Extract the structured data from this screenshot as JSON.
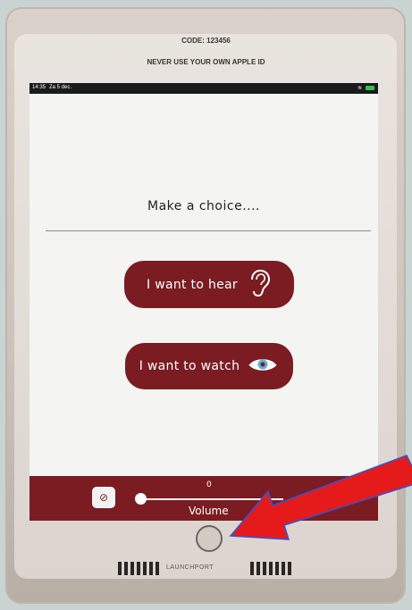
{
  "kiosk": {
    "code_label": "CODE: 123456",
    "warning_label": "NEVER USE YOUR OWN APPLE ID",
    "brand": "LAUNCHPORT"
  },
  "statusbar": {
    "time": "14:35",
    "date": "Za 5 dec."
  },
  "screen": {
    "headline": "Make a choice....",
    "buttons": {
      "hear": {
        "label": "I want to hear",
        "icon": "ear-icon"
      },
      "watch": {
        "label": "I want to watch",
        "icon": "eye-icon"
      }
    }
  },
  "volume": {
    "value": "0",
    "label": "Volume",
    "level_fraction": 0.0,
    "mute_icon": "speaker-muted-icon",
    "power_icon": "power-icon"
  },
  "colors": {
    "accent": "#7a1c22",
    "screen_bg": "#f4f4f2",
    "kiosk_frame": "#d9d1ca"
  }
}
